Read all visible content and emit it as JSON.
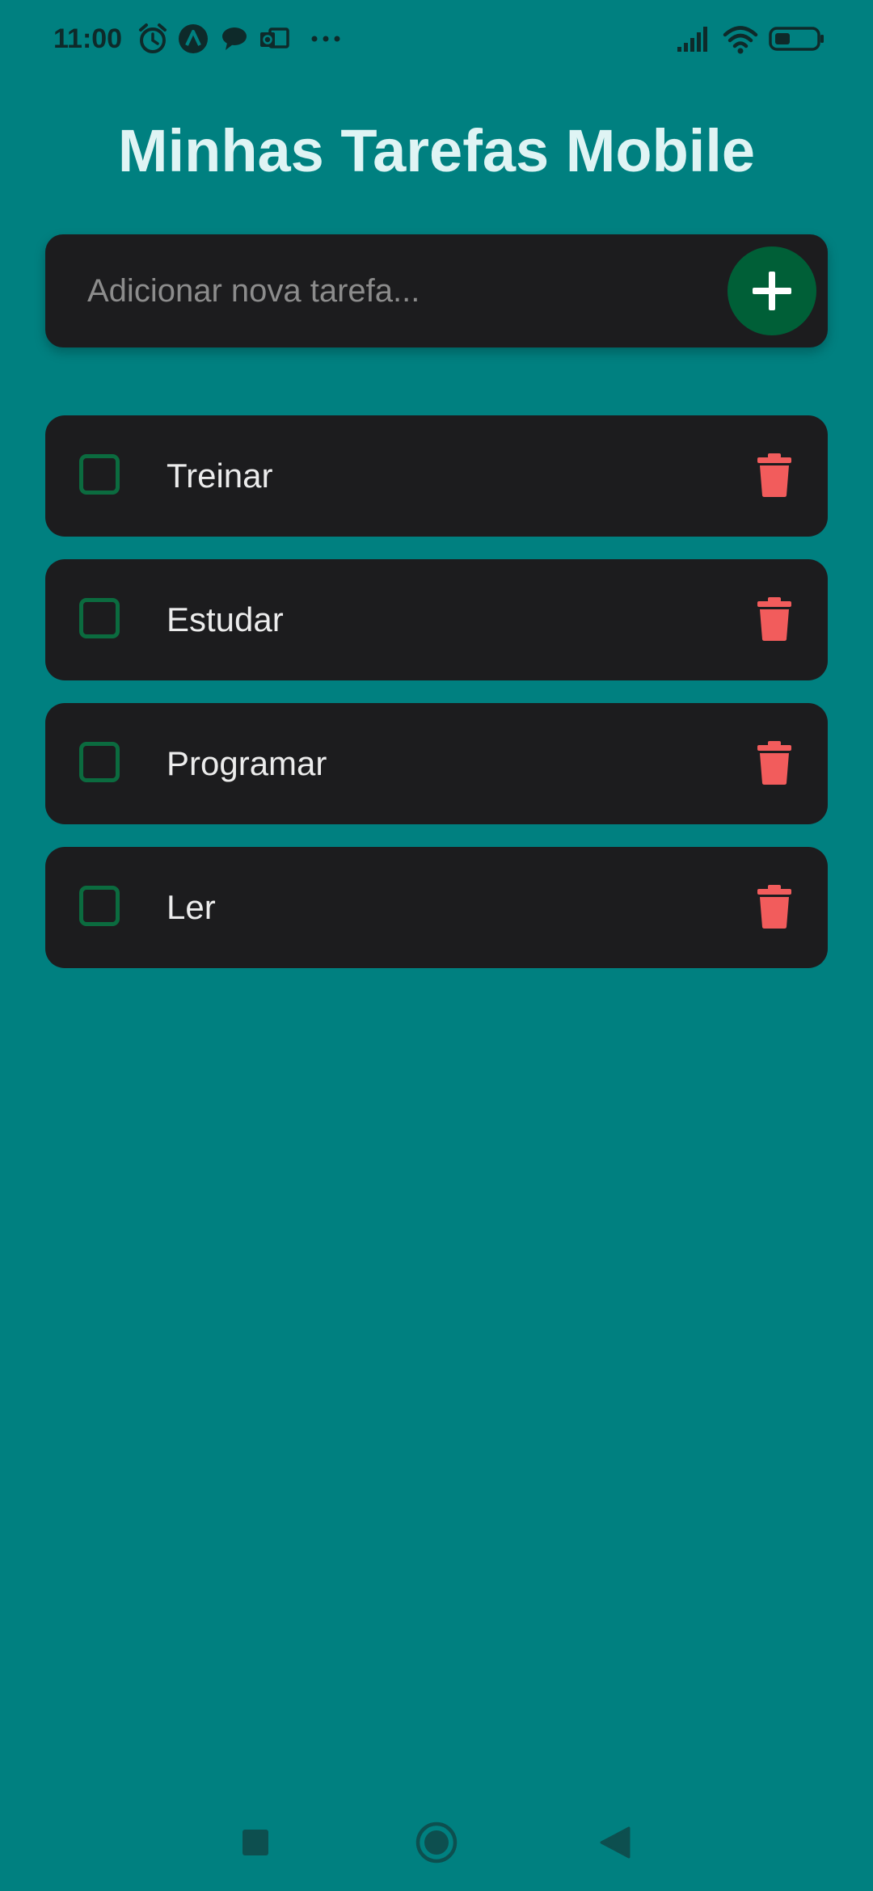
{
  "status_bar": {
    "time": "11:00",
    "icons": [
      "alarm-icon",
      "app-a-icon",
      "chat-bubble-icon",
      "outlook-icon",
      "more-icon",
      "signal-icon",
      "wifi-icon",
      "battery-icon"
    ]
  },
  "page": {
    "title": "Minhas Tarefas Mobile"
  },
  "add_bar": {
    "placeholder": "Adicionar nova tarefa...",
    "value": "",
    "button_icon": "plus-icon"
  },
  "tasks": [
    {
      "label": "Treinar",
      "done": false
    },
    {
      "label": "Estudar",
      "done": false
    },
    {
      "label": "Programar",
      "done": false
    },
    {
      "label": "Ler",
      "done": false
    }
  ],
  "colors": {
    "background": "#008080",
    "card": "#1c1c1e",
    "accent_green": "#005f37",
    "checkbox_border": "#0b6b3f",
    "delete_red": "#f25c5c",
    "title": "#dff4f4"
  },
  "nav_bar": {
    "icons": [
      "recent-apps-icon",
      "home-icon",
      "back-icon"
    ]
  }
}
